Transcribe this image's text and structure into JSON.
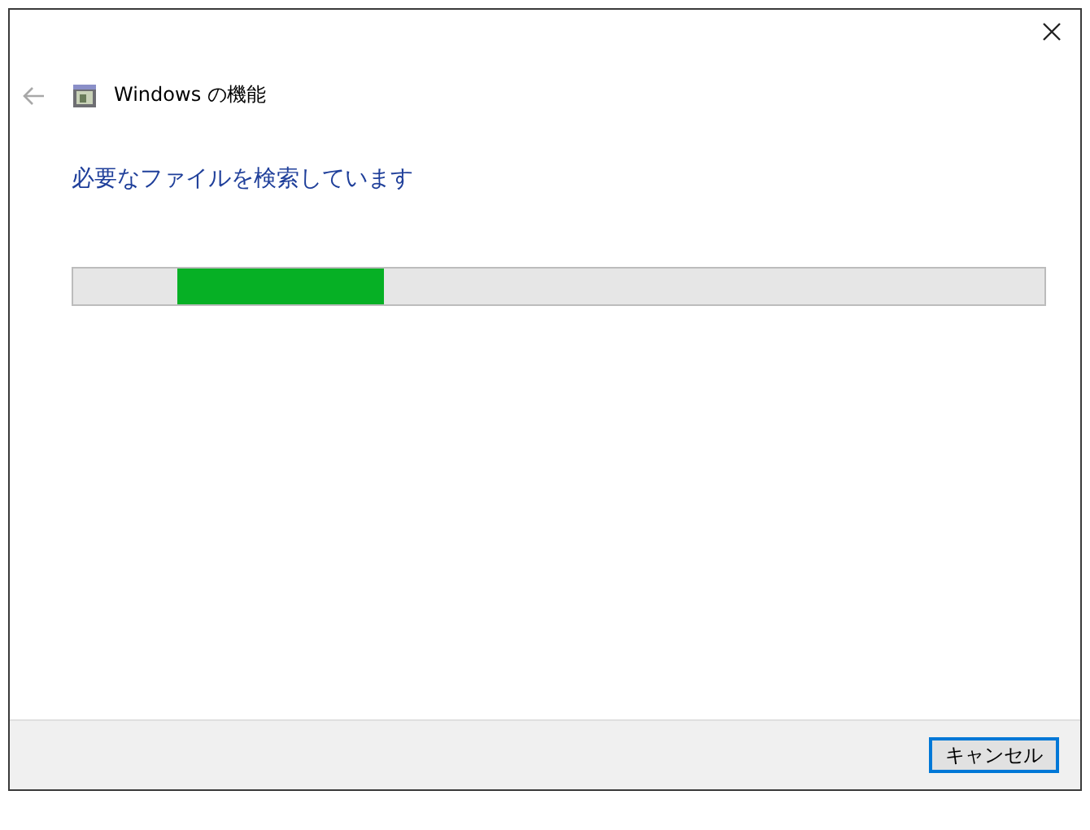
{
  "window": {
    "title": "Windows の機能",
    "back_enabled": false
  },
  "heading": "必要なファイルを検索しています",
  "progress": {
    "kind": "marquee"
  },
  "buttons": [
    {
      "label": "キャンセル",
      "default": true
    }
  ]
}
